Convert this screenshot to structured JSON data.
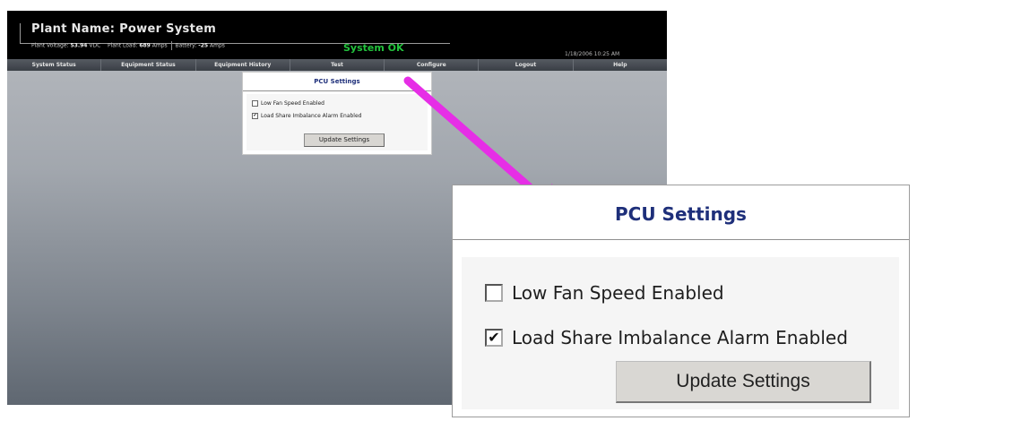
{
  "header": {
    "plant_label": "Plant Name:",
    "plant_value": "Power System",
    "voltage_label": "Plant Voltage:",
    "voltage_value": "53.94",
    "voltage_unit": "VDC",
    "load_label": "Plant Load:",
    "load_value": "689",
    "load_unit": "Amps",
    "battery_label": "Battery:",
    "battery_value": "-25",
    "battery_unit": "Amps",
    "status": "System OK",
    "timestamp": "1/18/2006 10:25 AM"
  },
  "nav": {
    "items": [
      "System Status",
      "Equipment Status",
      "Equipment History",
      "Test",
      "Configure",
      "Logout",
      "Help"
    ]
  },
  "panel": {
    "title": "PCU Settings",
    "options": [
      {
        "label": "Low Fan Speed Enabled",
        "checked": false
      },
      {
        "label": "Load Share Imbalance Alarm Enabled",
        "checked": true
      }
    ],
    "button": "Update Settings"
  },
  "colors": {
    "status_ok": "#22c23c",
    "title_blue": "#1e2f7a",
    "arrow": "#e62ee6",
    "header_bg": "#000000"
  },
  "icons": {
    "checkbox_checked": "check-mark",
    "callout": "magenta-arrow"
  }
}
